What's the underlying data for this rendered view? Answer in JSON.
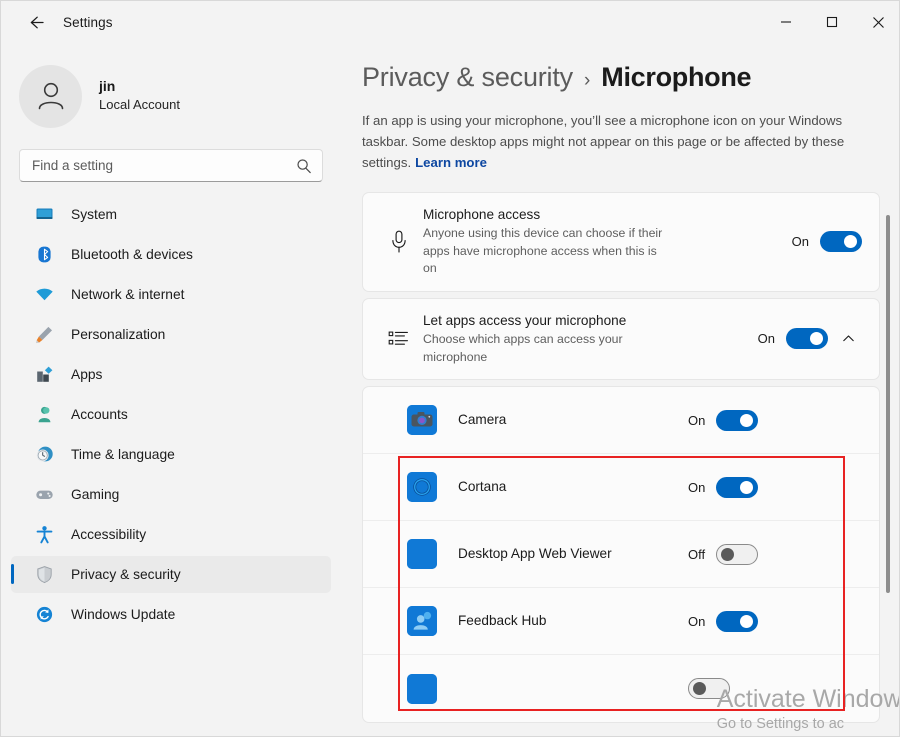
{
  "window": {
    "title": "Settings",
    "back_icon": "arrow-left-icon",
    "controls": [
      {
        "name": "minimize-button",
        "icon": "minimize-icon"
      },
      {
        "name": "maximize-button",
        "icon": "maximize-icon"
      },
      {
        "name": "close-button",
        "icon": "close-icon"
      }
    ]
  },
  "colors": {
    "accent": "#0067c0",
    "page_bg": "#f3f3f3",
    "card_bg": "#fbfbfb",
    "annotation": "#e82222",
    "link": "#0d47a1",
    "selected_row": "#eaeaea"
  },
  "account": {
    "name": "jin",
    "type": "Local Account",
    "avatar_icon": "person-avatar-icon"
  },
  "search": {
    "placeholder": "Find a setting",
    "value": "",
    "icon": "search-icon"
  },
  "sidebar": {
    "items": [
      {
        "label": "System",
        "icon": "monitor-icon",
        "selected": false
      },
      {
        "label": "Bluetooth & devices",
        "icon": "bluetooth-icon",
        "selected": false
      },
      {
        "label": "Network & internet",
        "icon": "wifi-icon",
        "selected": false
      },
      {
        "label": "Personalization",
        "icon": "paintbrush-icon",
        "selected": false
      },
      {
        "label": "Apps",
        "icon": "apps-icon",
        "selected": false
      },
      {
        "label": "Accounts",
        "icon": "account-person-icon",
        "selected": false
      },
      {
        "label": "Time & language",
        "icon": "clock-globe-icon",
        "selected": false
      },
      {
        "label": "Gaming",
        "icon": "gamepad-icon",
        "selected": false
      },
      {
        "label": "Accessibility",
        "icon": "accessibility-person-icon",
        "selected": false
      },
      {
        "label": "Privacy & security",
        "icon": "shield-icon",
        "selected": true
      },
      {
        "label": "Windows Update",
        "icon": "update-refresh-icon",
        "selected": false
      }
    ]
  },
  "main": {
    "breadcrumb": {
      "parent": "Privacy & security",
      "separator": "›",
      "current": "Microphone"
    },
    "description": "If an app is using your microphone, you’ll see a microphone icon on your Windows taskbar. Some desktop apps might not appear on this page or be affected by these settings.",
    "learn_more": "Learn more",
    "settings": [
      {
        "title": "Microphone access",
        "subtitle": "Anyone using this device can choose if their apps have microphone access when this is on",
        "icon": "microphone-icon",
        "state_label": "On",
        "toggle": "on",
        "has_chevron": false
      },
      {
        "title": "Let apps access your microphone",
        "subtitle": "Choose which apps can access your microphone",
        "icon": "app-list-icon",
        "state_label": "On",
        "toggle": "on",
        "has_chevron": true,
        "chevron_icon": "chevron-up-icon"
      }
    ],
    "apps": [
      {
        "name": "Camera",
        "icon": "camera-app-icon",
        "state_label": "On",
        "toggle": "on"
      },
      {
        "name": "Cortana",
        "icon": "cortana-app-icon",
        "state_label": "On",
        "toggle": "on"
      },
      {
        "name": "Desktop App Web Viewer",
        "icon": "desktop-app-web-viewer-icon",
        "state_label": "Off",
        "toggle": "off"
      },
      {
        "name": "Feedback Hub",
        "icon": "feedback-hub-app-icon",
        "state_label": "On",
        "toggle": "on"
      }
    ]
  },
  "watermark": {
    "line1": "Activate Windows",
    "line2": "Go to Settings to ac"
  },
  "scrollbar": {
    "name": "content-scrollbar"
  }
}
